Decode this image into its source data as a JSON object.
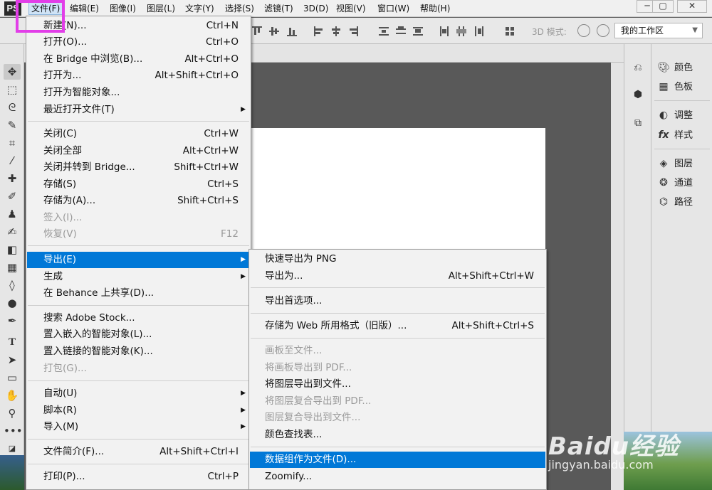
{
  "app": {
    "logo": "PS"
  },
  "menubar": {
    "items": [
      "文件(F)",
      "编辑(E)",
      "图像(I)",
      "图层(L)",
      "文字(Y)",
      "选择(S)",
      "滤镜(T)",
      "3D(D)",
      "视图(V)",
      "窗口(W)",
      "帮助(H)"
    ],
    "window_buttons": [
      "─",
      "▢",
      "✕"
    ]
  },
  "options_bar": {
    "label_3d": "3D 模式:",
    "workspace": "我的工作区"
  },
  "right_panels": {
    "items": [
      "颜色",
      "色板",
      "调整",
      "样式",
      "图层",
      "通道",
      "路径"
    ]
  },
  "file_menu": {
    "items": [
      {
        "label": "新建(N)...",
        "shortcut": "Ctrl+N"
      },
      {
        "label": "打开(O)...",
        "shortcut": "Ctrl+O"
      },
      {
        "label": "在 Bridge 中浏览(B)...",
        "shortcut": "Alt+Ctrl+O"
      },
      {
        "label": "打开为...",
        "shortcut": "Alt+Shift+Ctrl+O"
      },
      {
        "label": "打开为智能对象...",
        "shortcut": ""
      },
      {
        "label": "最近打开文件(T)",
        "shortcut": ""
      },
      {
        "label": "关闭(C)",
        "shortcut": "Ctrl+W"
      },
      {
        "label": "关闭全部",
        "shortcut": "Alt+Ctrl+W"
      },
      {
        "label": "关闭并转到 Bridge...",
        "shortcut": "Shift+Ctrl+W"
      },
      {
        "label": "存储(S)",
        "shortcut": "Ctrl+S"
      },
      {
        "label": "存储为(A)...",
        "shortcut": "Shift+Ctrl+S"
      },
      {
        "label": "签入(I)...",
        "shortcut": ""
      },
      {
        "label": "恢复(V)",
        "shortcut": "F12"
      },
      {
        "label": "导出(E)",
        "shortcut": ""
      },
      {
        "label": "生成",
        "shortcut": ""
      },
      {
        "label": "在 Behance 上共享(D)...",
        "shortcut": ""
      },
      {
        "label": "搜索 Adobe Stock...",
        "shortcut": ""
      },
      {
        "label": "置入嵌入的智能对象(L)...",
        "shortcut": ""
      },
      {
        "label": "置入链接的智能对象(K)...",
        "shortcut": ""
      },
      {
        "label": "打包(G)...",
        "shortcut": ""
      },
      {
        "label": "自动(U)",
        "shortcut": ""
      },
      {
        "label": "脚本(R)",
        "shortcut": ""
      },
      {
        "label": "导入(M)",
        "shortcut": ""
      },
      {
        "label": "文件简介(F)...",
        "shortcut": "Alt+Shift+Ctrl+I"
      },
      {
        "label": "打印(P)...",
        "shortcut": "Ctrl+P"
      }
    ]
  },
  "export_menu": {
    "items": [
      {
        "label": "快速导出为 PNG",
        "shortcut": ""
      },
      {
        "label": "导出为...",
        "shortcut": "Alt+Shift+Ctrl+W"
      },
      {
        "label": "导出首选项...",
        "shortcut": ""
      },
      {
        "label": "存储为 Web 所用格式（旧版）...",
        "shortcut": "Alt+Shift+Ctrl+S"
      },
      {
        "label": "画板至文件...",
        "shortcut": ""
      },
      {
        "label": "将画板导出到 PDF...",
        "shortcut": ""
      },
      {
        "label": "将图层导出到文件...",
        "shortcut": ""
      },
      {
        "label": "将图层复合导出到 PDF...",
        "shortcut": ""
      },
      {
        "label": "图层复合导出到文件...",
        "shortcut": ""
      },
      {
        "label": "颜色查找表...",
        "shortcut": ""
      },
      {
        "label": "数据组作为文件(D)...",
        "shortcut": ""
      },
      {
        "label": "Zoomify...",
        "shortcut": ""
      }
    ]
  },
  "watermark": {
    "brand": "Baidu经验",
    "url": "jingyan.baidu.com"
  },
  "colors": {
    "highlight": "#0078d7",
    "annotation": "#e23ee8"
  }
}
